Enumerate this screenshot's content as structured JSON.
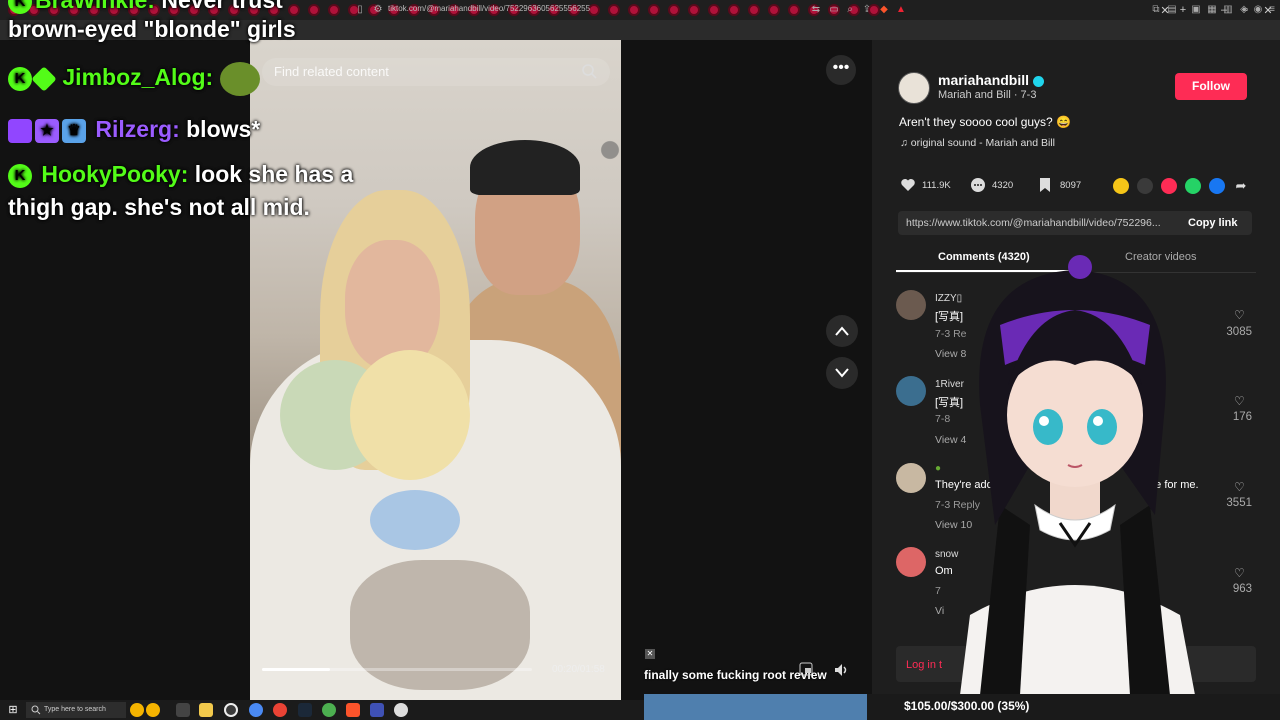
{
  "browser": {
    "url": "tiktok.com/@mariahandbill/video/7522963605625556255",
    "tab_count": 44
  },
  "chat": {
    "line0_user": "BraWinkle:",
    "line0_msg": "Never trust",
    "line0_cont": "brown-eyed \"blonde\" girls",
    "line1_user": "Jimboz_Alog:",
    "line2_user": "Rilzerg:",
    "line2_msg": "blows*",
    "line3_user": "HookyPooky:",
    "line3_msg": "look she has a",
    "line3_cont": "thigh gap. she's not all mid."
  },
  "video": {
    "search_placeholder": "Find related content",
    "time": "00:20/01:58",
    "progress": 0.25
  },
  "creator": {
    "username": "mariahandbill",
    "subline": "Mariah and Bill · 7-3",
    "follow_label": "Follow",
    "caption": "Aren't they soooo cool guys? 😄",
    "sound": "♫  original sound - Mariah and Bill"
  },
  "stats": {
    "likes": "111.9K",
    "comments": "4320",
    "saves": "8097"
  },
  "share": {
    "link": "https://www.tiktok.com/@mariahandbill/video/752296...",
    "copy_label": "Copy link"
  },
  "tabs": {
    "comments": "Comments (4320)",
    "creator_videos": "Creator videos"
  },
  "comments": [
    {
      "name": "IZZY▯",
      "text": "[写真]",
      "meta": "7-3     Re",
      "view": "View 8",
      "likes": "3085"
    },
    {
      "name": "1River",
      "text": "[写真]",
      "meta": "7-8",
      "view": "View 4",
      "likes": "176"
    },
    {
      "name": "●",
      "text": "They're ador",
      "text2": "me for me.",
      "meta": "7-3     Reply",
      "view": "View 10",
      "likes": "3551"
    },
    {
      "name": "snow",
      "text": "Om",
      "meta": "7",
      "view": "Vi",
      "likes": "963"
    }
  ],
  "login_label": "Log in t",
  "overlay": {
    "alert": "finally some fucking root review",
    "goal": "$105.00/$300.00 (35%)",
    "goal_fraction": 0.35
  },
  "taskbar": {
    "search_placeholder": "Type here to search"
  },
  "colors": {
    "tiktok_red": "#fe2c55",
    "kick_green": "#53fc18",
    "goal_blue": "#4f7fae"
  }
}
